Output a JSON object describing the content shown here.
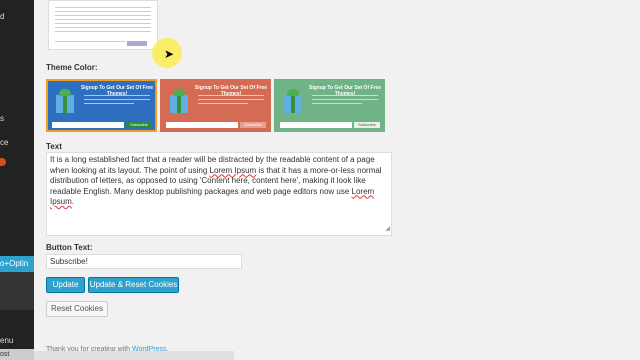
{
  "sidebar": {
    "fragments": [
      "d",
      "s",
      "ce",
      "enu",
      "ost"
    ],
    "active_item": "o+Optin"
  },
  "labels": {
    "theme_color": "Theme Color:",
    "text": "Text",
    "button_text": "Button Text:"
  },
  "themes": [
    {
      "title": "Signup To Get Our Set Of Free Themes!",
      "submit": "Subscribe",
      "color": "#2f6fbf",
      "selected": true
    },
    {
      "title": "Signup To Get Our Set Of Free Themes!",
      "submit": "Subscribe",
      "color": "#d46b52",
      "selected": false
    },
    {
      "title": "Signup To Get Our Set Of Free Themes!",
      "submit": "Subscribe",
      "color": "#6fb386",
      "selected": false
    }
  ],
  "text_field": {
    "part1": "It is a long established fact that a reader will be distracted by the readable content of a page when looking at its layout. The point of using ",
    "lorem1": "Lorem Ipsum",
    "part2": " is that it has a more-or-less normal distribution of letters, as opposed to using 'Content here, content here', making it look like readable English. Many desktop publishing packages and web page editors now use ",
    "lorem2": "Lorem Ipsum",
    "part3": "."
  },
  "button_text_value": "Subscribe!",
  "buttons": {
    "update": "Update",
    "update_reset": "Update & Reset Cookies",
    "reset": "Reset Cookies"
  },
  "footer": {
    "text": "Thank you for creating with ",
    "link": "WordPress",
    "suffix": "."
  },
  "colors": {
    "accent": "#2ea2cc",
    "sidebar": "#222222",
    "selected_border": "#f0a020"
  }
}
